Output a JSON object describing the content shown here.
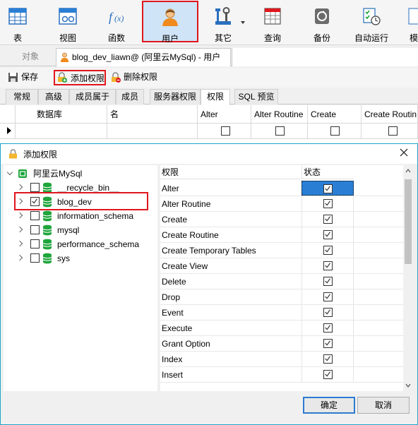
{
  "toolbar": {
    "items": [
      {
        "label": "表",
        "icon": "table-icon"
      },
      {
        "label": "视图",
        "icon": "view-icon"
      },
      {
        "label": "函数",
        "icon": "function-icon"
      },
      {
        "label": "用户",
        "icon": "user-icon"
      },
      {
        "label": "其它",
        "icon": "tools-icon"
      },
      {
        "label": "查询",
        "icon": "query-icon"
      },
      {
        "label": "备份",
        "icon": "backup-icon"
      },
      {
        "label": "自动运行",
        "icon": "automation-icon"
      },
      {
        "label": "模",
        "icon": "model-icon"
      }
    ]
  },
  "object_tabs": {
    "objects_label": "对象",
    "current_label": "blog_dev_liawn@ (阿里云MySql) - 用户"
  },
  "actions": {
    "save": "保存",
    "add_privilege": "添加权限",
    "delete_privilege": "删除权限"
  },
  "sub_tabs": [
    "常规",
    "高级",
    "成员属于",
    "成员",
    "服务器权限",
    "权限",
    "SQL 预览"
  ],
  "grid": {
    "headers": [
      "数据库",
      "名",
      "Alter",
      "Alter Routine",
      "Create",
      "Create Routin"
    ]
  },
  "dialog": {
    "title": "添加权限",
    "tree": {
      "root": "阿里云MySql",
      "databases": [
        {
          "name": "__recycle_bin__",
          "checked": false
        },
        {
          "name": "blog_dev",
          "checked": true
        },
        {
          "name": "information_schema",
          "checked": false
        },
        {
          "name": "mysql",
          "checked": false
        },
        {
          "name": "performance_schema",
          "checked": false
        },
        {
          "name": "sys",
          "checked": false
        }
      ]
    },
    "privileges": {
      "col_name": "权限",
      "col_status": "状态",
      "rows": [
        {
          "name": "Alter",
          "checked": true
        },
        {
          "name": "Alter Routine",
          "checked": true
        },
        {
          "name": "Create",
          "checked": true
        },
        {
          "name": "Create Routine",
          "checked": true
        },
        {
          "name": "Create Temporary Tables",
          "checked": true
        },
        {
          "name": "Create View",
          "checked": true
        },
        {
          "name": "Delete",
          "checked": true
        },
        {
          "name": "Drop",
          "checked": true
        },
        {
          "name": "Event",
          "checked": true
        },
        {
          "name": "Execute",
          "checked": true
        },
        {
          "name": "Grant Option",
          "checked": true
        },
        {
          "name": "Index",
          "checked": true
        },
        {
          "name": "Insert",
          "checked": true
        }
      ]
    },
    "ok": "确定",
    "cancel": "取消"
  },
  "colors": {
    "accent": "#1aa7c9",
    "highlight_red": "#e0161d",
    "selection_blue": "#2a7fd4",
    "db_green": "#1fa53c"
  }
}
